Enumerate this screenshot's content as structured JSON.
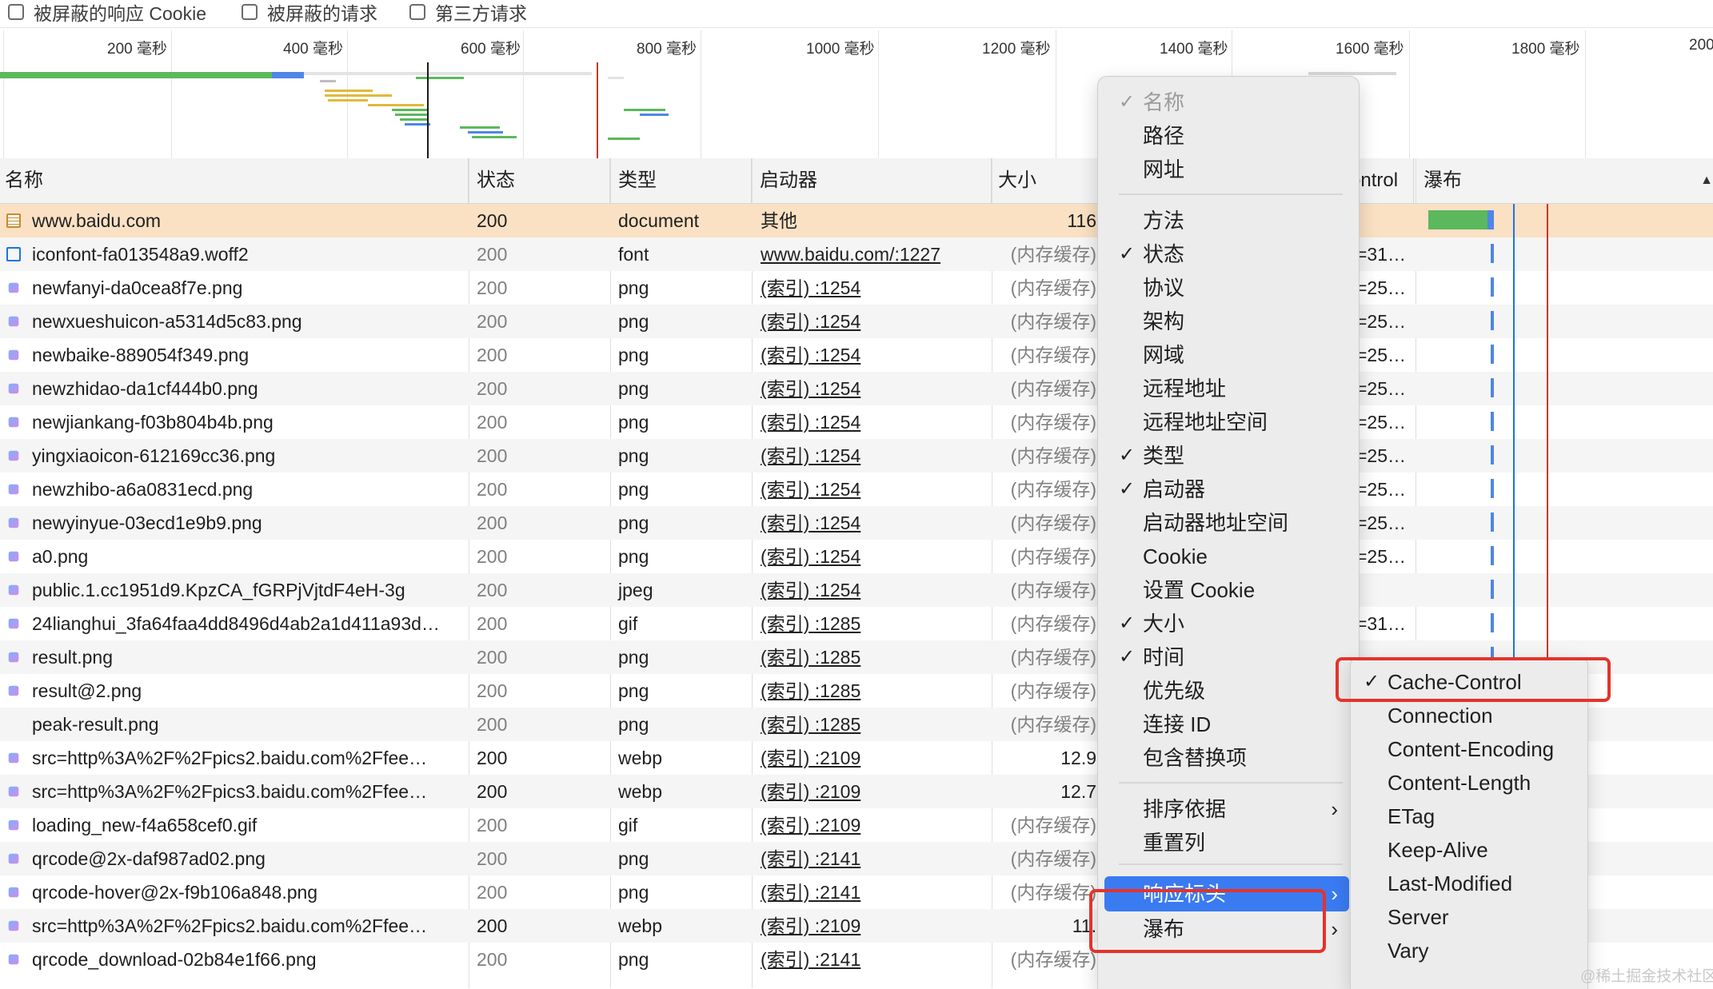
{
  "filters": [
    {
      "label": "被屏蔽的响应 Cookie",
      "checked": false
    },
    {
      "label": "被屏蔽的请求",
      "checked": false
    },
    {
      "label": "第三方请求",
      "checked": false
    }
  ],
  "overview": {
    "ticks": [
      "200 毫秒",
      "400 毫秒",
      "600 毫秒",
      "800 毫秒",
      "1000 毫秒",
      "1200 毫秒",
      "1400 毫秒",
      "1600 毫秒",
      "1800 毫秒",
      "200"
    ]
  },
  "columns": {
    "name": "名称",
    "status": "状态",
    "type": "类型",
    "initiator": "启动器",
    "size": "大小",
    "cache_control": "ontrol",
    "waterfall": "瀑布"
  },
  "rows": [
    {
      "name": "www.baidu.com",
      "status": "200",
      "type": "document",
      "initiator": "其他",
      "size": "116",
      "cc": "",
      "icon": "document-icon",
      "selected": true
    },
    {
      "name": "iconfont-fa013548a9.woff2",
      "status": "200",
      "type": "font",
      "initiator": "www.baidu.com/:1227",
      "size": "(内存缓存)",
      "cc": "=31…",
      "icon": "font-icon"
    },
    {
      "name": "newfanyi-da0cea8f7e.png",
      "status": "200",
      "type": "png",
      "initiator": "(索引) :1254",
      "size": "(内存缓存)",
      "cc": "=25…",
      "icon": "image-icon"
    },
    {
      "name": "newxueshuicon-a5314d5c83.png",
      "status": "200",
      "type": "png",
      "initiator": "(索引) :1254",
      "size": "(内存缓存)",
      "cc": "=25…",
      "icon": "image-icon"
    },
    {
      "name": "newbaike-889054f349.png",
      "status": "200",
      "type": "png",
      "initiator": "(索引) :1254",
      "size": "(内存缓存)",
      "cc": "=25…",
      "icon": "image-icon"
    },
    {
      "name": "newzhidao-da1cf444b0.png",
      "status": "200",
      "type": "png",
      "initiator": "(索引) :1254",
      "size": "(内存缓存)",
      "cc": "=25…",
      "icon": "image-icon"
    },
    {
      "name": "newjiankang-f03b804b4b.png",
      "status": "200",
      "type": "png",
      "initiator": "(索引) :1254",
      "size": "(内存缓存)",
      "cc": "=25…",
      "icon": "image-icon"
    },
    {
      "name": "yingxiaoicon-612169cc36.png",
      "status": "200",
      "type": "png",
      "initiator": "(索引) :1254",
      "size": "(内存缓存)",
      "cc": "=25…",
      "icon": "image-icon"
    },
    {
      "name": "newzhibo-a6a0831ecd.png",
      "status": "200",
      "type": "png",
      "initiator": "(索引) :1254",
      "size": "(内存缓存)",
      "cc": "=25…",
      "icon": "image-icon"
    },
    {
      "name": "newyinyue-03ecd1e9b9.png",
      "status": "200",
      "type": "png",
      "initiator": "(索引) :1254",
      "size": "(内存缓存)",
      "cc": "=25…",
      "icon": "image-icon"
    },
    {
      "name": "a0.png",
      "status": "200",
      "type": "png",
      "initiator": "(索引) :1254",
      "size": "(内存缓存)",
      "cc": "=25…",
      "icon": "image-icon"
    },
    {
      "name": "public.1.cc1951d9.KpzCA_fGRPjVjtdF4eH-3g",
      "status": "200",
      "type": "jpeg",
      "initiator": "(索引) :1254",
      "size": "(内存缓存)",
      "cc": "",
      "icon": "image-icon"
    },
    {
      "name": "24lianghui_3fa64faa4dd8496d4ab2a1d411a93d…",
      "status": "200",
      "type": "gif",
      "initiator": "(索引) :1285",
      "size": "(内存缓存)",
      "cc": "=31…",
      "icon": "image-icon"
    },
    {
      "name": "result.png",
      "status": "200",
      "type": "png",
      "initiator": "(索引) :1285",
      "size": "(内存缓存)",
      "cc": "",
      "icon": "image-icon"
    },
    {
      "name": "result@2.png",
      "status": "200",
      "type": "png",
      "initiator": "(索引) :1285",
      "size": "(内存缓存)",
      "cc": "",
      "icon": "image-icon"
    },
    {
      "name": "peak-result.png",
      "status": "200",
      "type": "png",
      "initiator": "(索引) :1285",
      "size": "(内存缓存)",
      "cc": "",
      "icon": ""
    },
    {
      "name": "src=http%3A%2F%2Fpics2.baidu.com%2Ffee…",
      "status": "200",
      "type": "webp",
      "initiator": "(索引) :2109",
      "size": "12.9",
      "cc": "",
      "icon": "image-icon",
      "strong": true
    },
    {
      "name": "src=http%3A%2F%2Fpics3.baidu.com%2Ffee…",
      "status": "200",
      "type": "webp",
      "initiator": "(索引) :2109",
      "size": "12.7",
      "cc": "",
      "icon": "image-icon",
      "strong": true
    },
    {
      "name": "loading_new-f4a658cef0.gif",
      "status": "200",
      "type": "gif",
      "initiator": "(索引) :2109",
      "size": "(内存缓存)",
      "cc": "",
      "icon": "image-icon"
    },
    {
      "name": "qrcode@2x-daf987ad02.png",
      "status": "200",
      "type": "png",
      "initiator": "(索引) :2141",
      "size": "(内存缓存)",
      "cc": "",
      "icon": "image-icon"
    },
    {
      "name": "qrcode-hover@2x-f9b106a848.png",
      "status": "200",
      "type": "png",
      "initiator": "(索引) :2141",
      "size": "(内存缓存)",
      "cc": "",
      "icon": "image-icon"
    },
    {
      "name": "src=http%3A%2F%2Fpics2.baidu.com%2Ffee…",
      "status": "200",
      "type": "webp",
      "initiator": "(索引) :2109",
      "size": "11.",
      "cc": "",
      "icon": "image-icon",
      "strong": true
    },
    {
      "name": "qrcode_download-02b84e1f66.png",
      "status": "200",
      "type": "png",
      "initiator": "(索引) :2141",
      "size": "(内存缓存)",
      "cc": "",
      "icon": "image-icon"
    }
  ],
  "context_menu": {
    "items": [
      {
        "label": "名称",
        "checked": true,
        "disabled": true
      },
      {
        "label": "路径",
        "checked": false
      },
      {
        "label": "网址",
        "checked": false
      },
      {
        "label": "方法",
        "checked": false
      },
      {
        "label": "状态",
        "checked": true
      },
      {
        "label": "协议",
        "checked": false
      },
      {
        "label": "架构",
        "checked": false
      },
      {
        "label": "网域",
        "checked": false
      },
      {
        "label": "远程地址",
        "checked": false
      },
      {
        "label": "远程地址空间",
        "checked": false
      },
      {
        "label": "类型",
        "checked": true
      },
      {
        "label": "启动器",
        "checked": true
      },
      {
        "label": "启动器地址空间",
        "checked": false
      },
      {
        "label": "Cookie",
        "checked": false
      },
      {
        "label": "设置 Cookie",
        "checked": false
      },
      {
        "label": "大小",
        "checked": true
      },
      {
        "label": "时间",
        "checked": true
      },
      {
        "label": "优先级",
        "checked": false
      },
      {
        "label": "连接 ID",
        "checked": false
      },
      {
        "label": "包含替换项",
        "checked": false
      },
      {
        "label": "排序依据",
        "checked": false,
        "submenu": true
      },
      {
        "label": "重置列",
        "checked": false
      },
      {
        "label": "响应标头",
        "checked": false,
        "submenu": true,
        "highlighted": true
      },
      {
        "label": "瀑布",
        "checked": false,
        "submenu": true
      }
    ]
  },
  "response_headers_menu": {
    "items": [
      {
        "label": "Cache-Control",
        "checked": true
      },
      {
        "label": "Connection",
        "checked": false
      },
      {
        "label": "Content-Encoding",
        "checked": false
      },
      {
        "label": "Content-Length",
        "checked": false
      },
      {
        "label": "ETag",
        "checked": false
      },
      {
        "label": "Keep-Alive",
        "checked": false
      },
      {
        "label": "Last-Modified",
        "checked": false
      },
      {
        "label": "Server",
        "checked": false
      },
      {
        "label": "Vary",
        "checked": false
      }
    ]
  },
  "watermark": "@稀土掘金技术社区",
  "colors": {
    "selected_row": "#fae1c4",
    "menu_highlight": "#3a7bf2",
    "annotation_red": "#e5332a",
    "waterfall_blue": "#1a73e8",
    "waterfall_red": "#c0392b",
    "waterfall_green": "#5cb85c"
  }
}
